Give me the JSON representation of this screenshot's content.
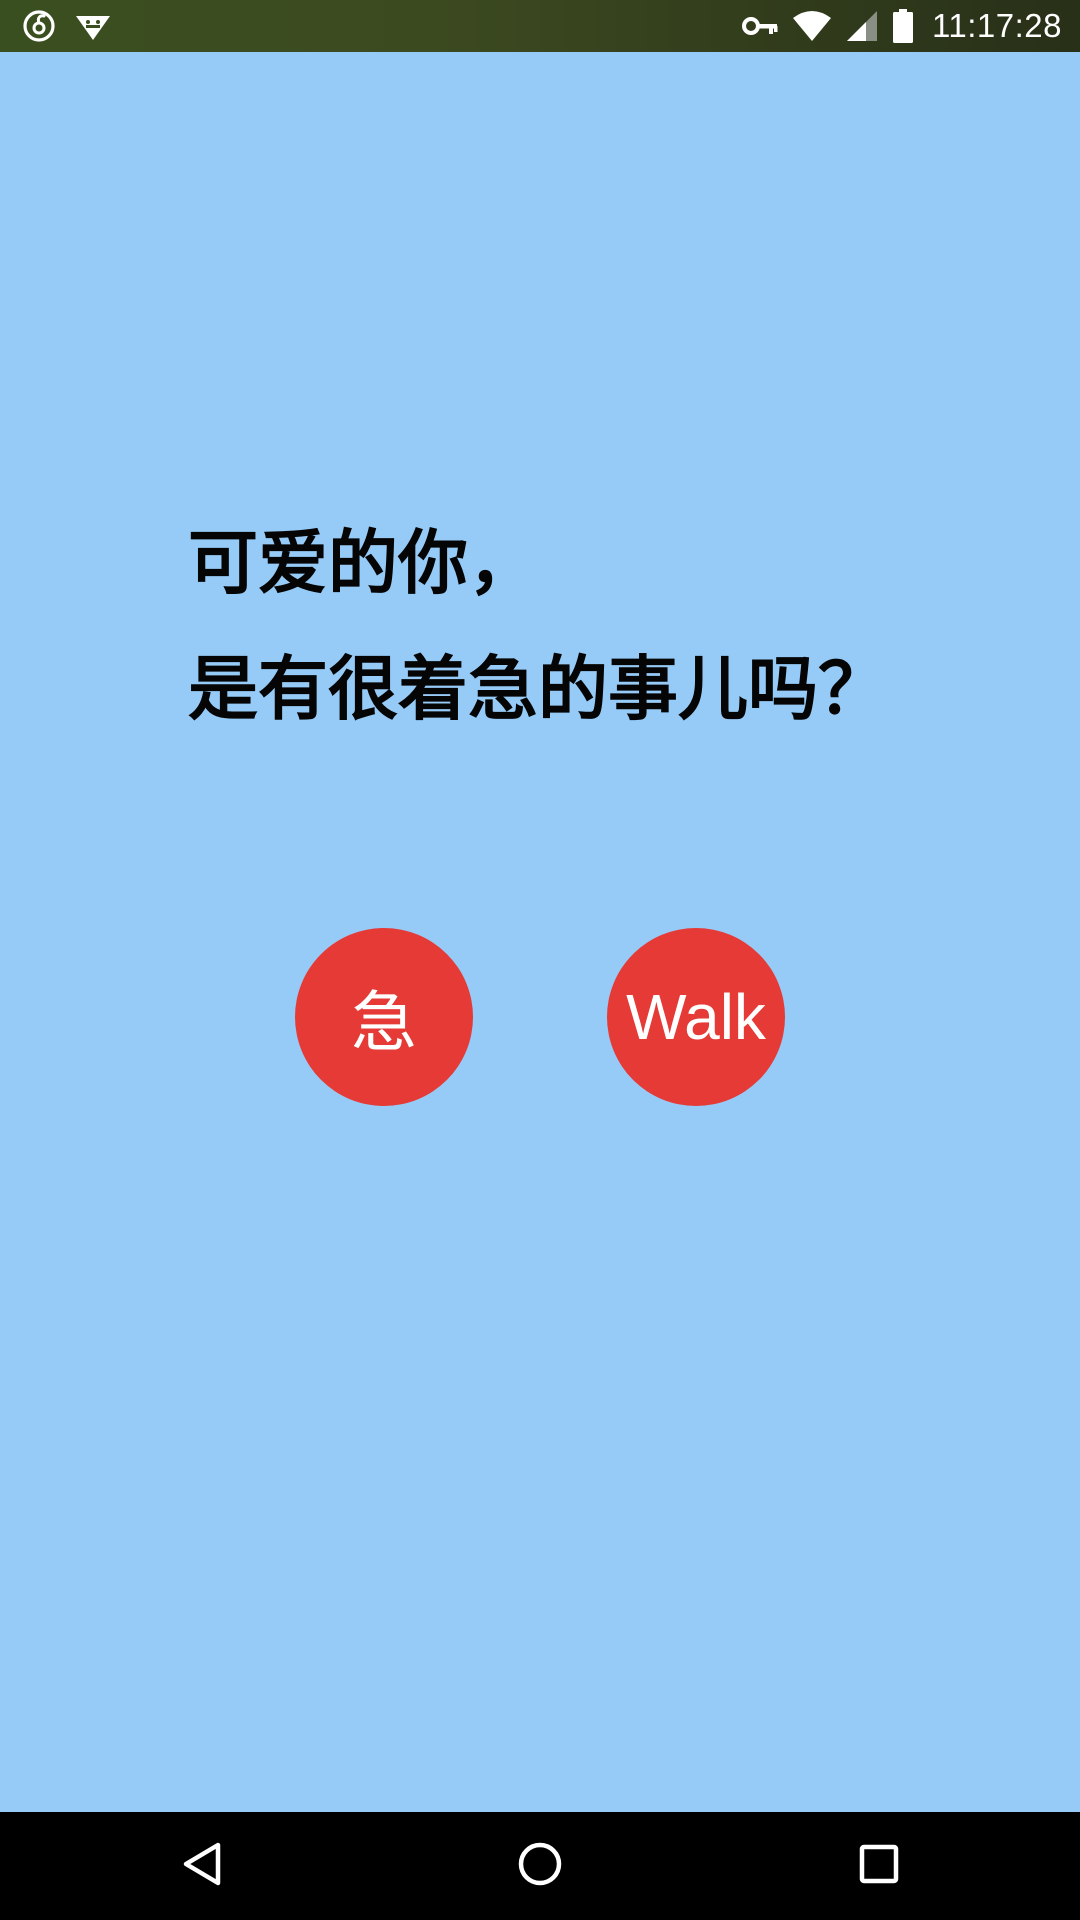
{
  "status_bar": {
    "time": "11:17:28",
    "left_icons": [
      "netease-music-icon",
      "android-debug-icon"
    ],
    "right_icons": [
      "vpn-key-icon",
      "wifi-icon",
      "cell-signal-icon",
      "battery-icon"
    ]
  },
  "question": {
    "line1": "可爱的你，",
    "line2": "是有很着急的事儿吗？"
  },
  "buttons": {
    "urgent_label": "急",
    "walk_label": "Walk"
  },
  "nav_bar": {
    "icons": [
      "back-icon",
      "home-icon",
      "recents-icon"
    ]
  },
  "colors": {
    "background": "#96cbf7",
    "button": "#e53a36",
    "status_bar": "#3a4f1f",
    "nav_bar": "#000000",
    "text": "#050505"
  }
}
